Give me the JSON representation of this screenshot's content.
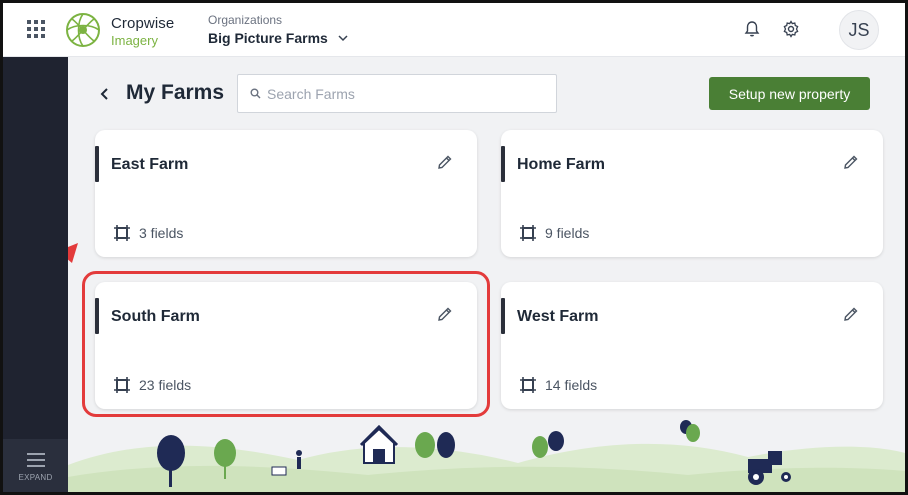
{
  "topbar": {
    "brand_name": "Cropwise",
    "brand_sub": "Imagery",
    "org_label": "Organizations",
    "org_name": "Big Picture Farms",
    "avatar_initials": "JS"
  },
  "sidebar": {
    "expand_label": "EXPAND"
  },
  "main": {
    "title": "My Farms",
    "search_placeholder": "Search Farms",
    "setup_button": "Setup new property"
  },
  "farms": [
    {
      "name": "East Farm",
      "fields": "3 fields"
    },
    {
      "name": "Home Farm",
      "fields": "9 fields"
    },
    {
      "name": "South Farm",
      "fields": "23 fields"
    },
    {
      "name": "West Farm",
      "fields": "14 fields"
    }
  ],
  "colors": {
    "accent_green": "#4a7f35",
    "brand_green": "#7cb342",
    "sidebar": "#1f2330",
    "highlight_red": "#e33b3b",
    "background": "#f1f2f4"
  },
  "icons": [
    "apps-grid-icon",
    "cropwise-logo-icon",
    "chevron-down-icon",
    "bell-icon",
    "gear-icon",
    "back-chevron-icon",
    "search-icon",
    "edit-pencil-icon",
    "field-frame-icon",
    "menu-icon",
    "arrow-annotation-icon"
  ]
}
